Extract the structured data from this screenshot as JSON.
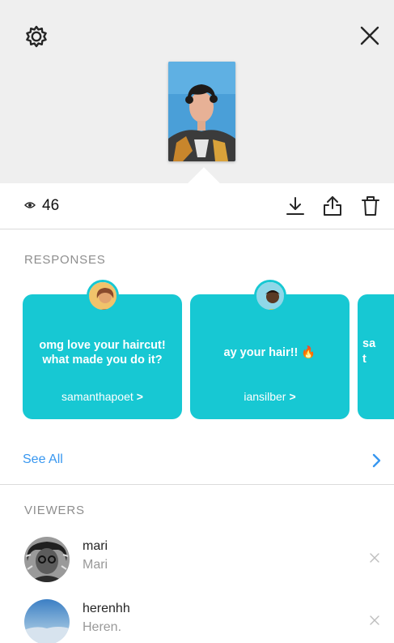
{
  "header": {
    "settings_icon": "gear-icon",
    "close_icon": "close-icon"
  },
  "stats": {
    "view_count": "46",
    "icons": [
      "eye-icon",
      "download-icon",
      "share-icon",
      "trash-icon"
    ]
  },
  "responses": {
    "section_label": "RESPONSES",
    "cards": [
      {
        "text": "omg love your haircut! what made you do it?",
        "username": "samanthapoet",
        "chevron": ">"
      },
      {
        "text": "ay your hair!! 🔥",
        "username": "iansilber",
        "chevron": ">"
      },
      {
        "text": "sa t s",
        "username": "",
        "chevron": ""
      }
    ],
    "see_all_label": "See All"
  },
  "viewers": {
    "section_label": "VIEWERS",
    "items": [
      {
        "username": "mari",
        "full_name": "Mari"
      },
      {
        "username": "herenhh",
        "full_name": "Heren."
      }
    ]
  },
  "colors": {
    "card": "#17c8d3",
    "link": "#3897f0",
    "panel": "#efefef"
  }
}
